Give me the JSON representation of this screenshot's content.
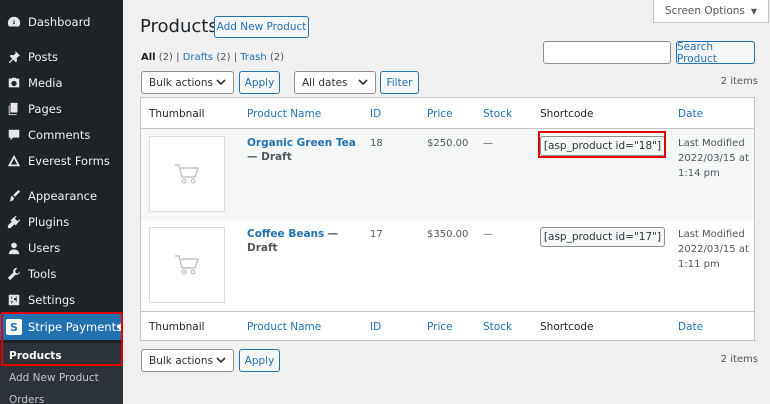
{
  "sidebar": {
    "items": [
      {
        "label": "Dashboard",
        "icon": "dashboard-icon"
      },
      {
        "label": "Posts",
        "icon": "pin-icon"
      },
      {
        "label": "Media",
        "icon": "media-icon"
      },
      {
        "label": "Pages",
        "icon": "pages-icon"
      },
      {
        "label": "Comments",
        "icon": "comment-icon"
      },
      {
        "label": "Everest Forms",
        "icon": "everest-forms-icon"
      },
      {
        "label": "Appearance",
        "icon": "brush-icon"
      },
      {
        "label": "Plugins",
        "icon": "plugin-icon"
      },
      {
        "label": "Users",
        "icon": "user-icon"
      },
      {
        "label": "Tools",
        "icon": "wrench-icon"
      },
      {
        "label": "Settings",
        "icon": "settings-icon"
      },
      {
        "label": "Stripe Payments",
        "icon": "stripe-s-icon",
        "logo_letter": "S"
      }
    ],
    "submenu": [
      "Products",
      "Add New Product",
      "Orders"
    ]
  },
  "header": {
    "title": "Products",
    "add_new": "Add New Product",
    "screen_options": "Screen Options"
  },
  "filters": {
    "all": "All",
    "all_count": "(2)",
    "drafts": "Drafts",
    "drafts_count": "(2)",
    "trash": "Trash",
    "trash_count": "(2)",
    "sep": "|"
  },
  "search": {
    "button": "Search Product",
    "value": ""
  },
  "toolbar": {
    "bulk_actions": "Bulk actions",
    "apply": "Apply",
    "all_dates": "All dates",
    "filter": "Filter",
    "items_count": "2 items"
  },
  "table": {
    "columns": [
      "Thumbnail",
      "Product Name",
      "ID",
      "Price",
      "Stock",
      "Shortcode",
      "Date"
    ],
    "rows": [
      {
        "name": "Organic Green Tea",
        "state": "— Draft",
        "id": "18",
        "price": "$250.00",
        "stock": "—",
        "shortcode": "[asp_product id=\"18\"]",
        "date_label": "Last Modified",
        "date": "2022/03/15 at",
        "time": "1:14 pm"
      },
      {
        "name": "Coffee Beans",
        "state": "— Draft",
        "id": "17",
        "price": "$350.00",
        "stock": "—",
        "shortcode": "[asp_product id=\"17\"]",
        "date_label": "Last Modified",
        "date": "2022/03/15 at",
        "time": "1:11 pm"
      }
    ]
  },
  "colors": {
    "sidebar_bg": "#1d2327",
    "accent": "#2271b1",
    "highlight": "#e00000"
  }
}
